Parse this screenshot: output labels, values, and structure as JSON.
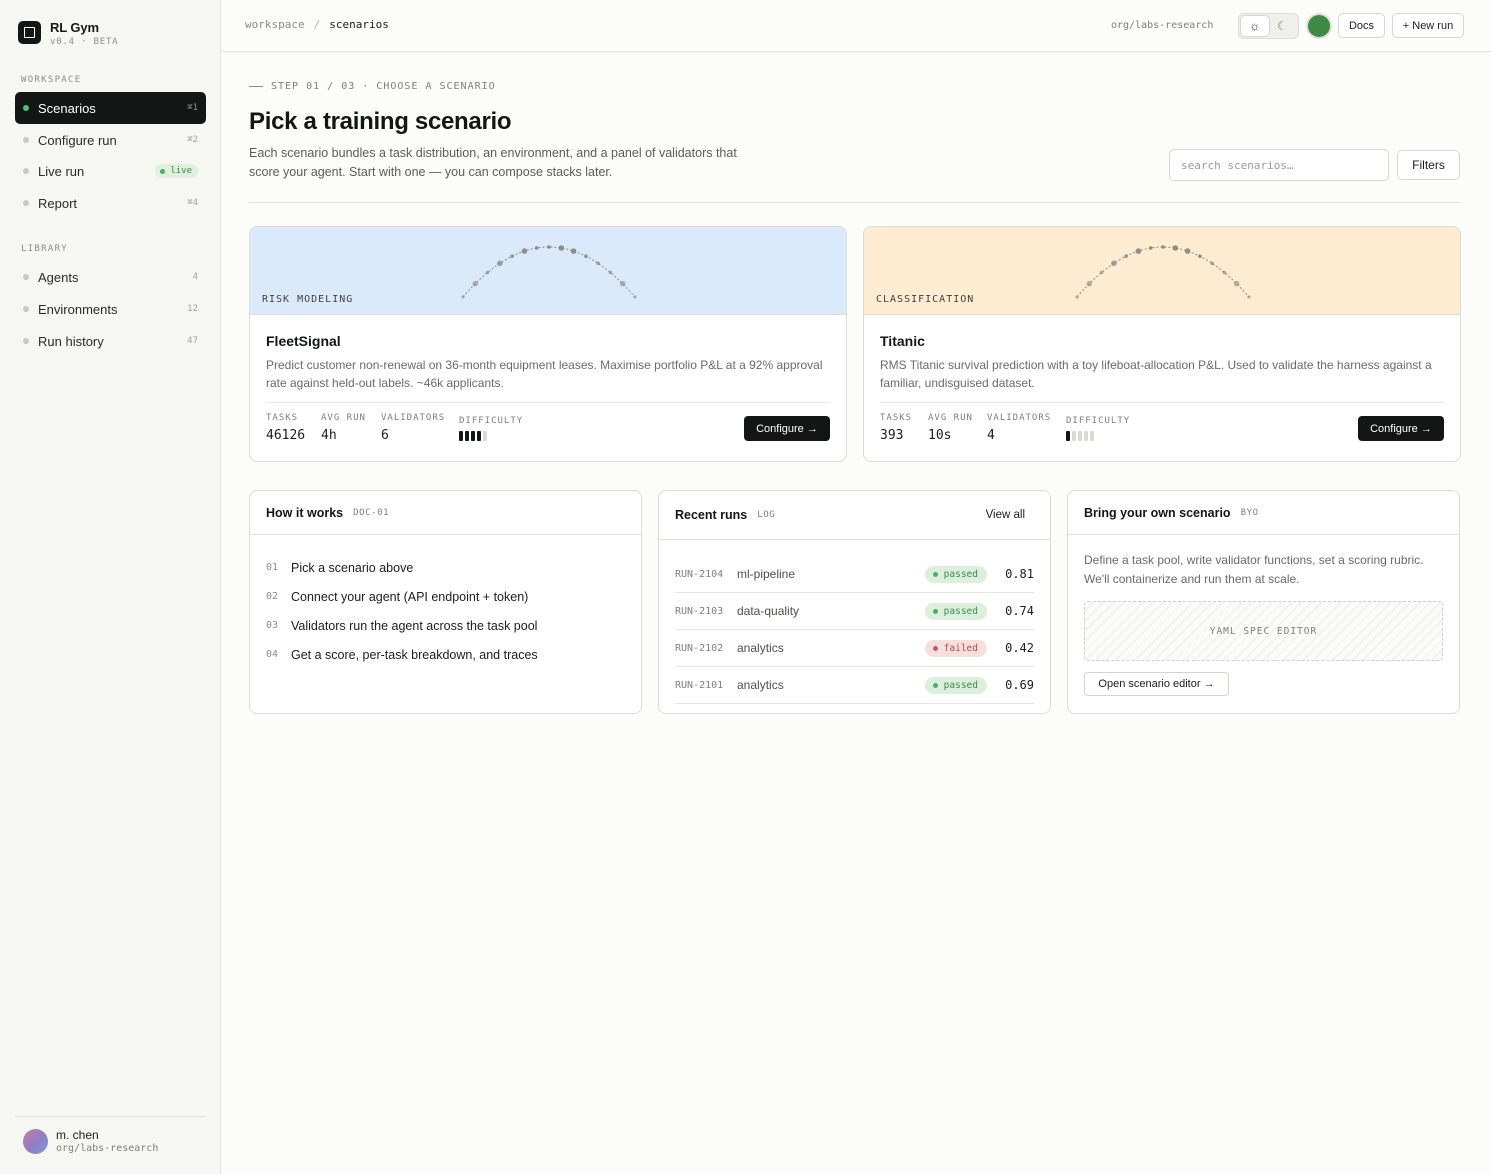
{
  "brand": {
    "name": "RL Gym",
    "version": "v0.4 · BETA"
  },
  "sidebar": {
    "workspace_label": "WORKSPACE",
    "workspace_items": [
      {
        "label": "Scenarios",
        "meta": "⌘1"
      },
      {
        "label": "Configure run",
        "meta": "⌘2"
      },
      {
        "label": "Live run",
        "meta": "live"
      },
      {
        "label": "Report",
        "meta": "⌘4"
      }
    ],
    "library_label": "LIBRARY",
    "library_items": [
      {
        "label": "Agents",
        "meta": "4"
      },
      {
        "label": "Environments",
        "meta": "12"
      },
      {
        "label": "Run history",
        "meta": "47"
      }
    ],
    "user": {
      "name": "m. chen",
      "org": "org/labs-research"
    }
  },
  "topbar": {
    "breadcrumb": [
      "workspace",
      "scenarios"
    ],
    "org": "org/labs-research",
    "theme": "light",
    "docs_label": "Docs",
    "new_run_label": "+ New run",
    "status_color": "#3d8a45"
  },
  "header": {
    "step": "STEP 01 / 03 · CHOOSE A SCENARIO",
    "title": "Pick a training scenario",
    "description": "Each scenario bundles a task distribution, an environment, and a panel of validators that score your agent. Start with one — you can compose stacks later.",
    "search_placeholder": "search scenarios…",
    "filters_label": "Filters"
  },
  "scenarios": [
    {
      "tag": "RISK MODELING",
      "name": "FleetSignal",
      "description": "Predict customer non-renewal on 36-month equipment leases. Maximise portfolio P&L at a 92% approval rate against held-out labels. ~46k applicants.",
      "hero_color": "#dbeafb",
      "stats": {
        "tasks_label": "TASKS",
        "tasks": "46126",
        "avg_run_label": "AVG RUN",
        "avg_run": "4h",
        "validators_label": "VALIDATORS",
        "validators": "6",
        "difficulty_label": "DIFFICULTY",
        "difficulty": 4,
        "difficulty_max": 5
      },
      "configure_label": "Configure →"
    },
    {
      "tag": "CLASSIFICATION",
      "name": "Titanic",
      "description": "RMS Titanic survival prediction with a toy lifeboat-allocation P&L. Used to validate the harness against a familiar, undisguised dataset.",
      "hero_color": "#fdebd2",
      "stats": {
        "tasks_label": "TASKS",
        "tasks": "393",
        "avg_run_label": "AVG RUN",
        "avg_run": "10s",
        "validators_label": "VALIDATORS",
        "validators": "4",
        "difficulty_label": "DIFFICULTY",
        "difficulty": 1,
        "difficulty_max": 5
      },
      "configure_label": "Configure →"
    }
  ],
  "how_it_works": {
    "title": "How it works",
    "tag": "DOC-01",
    "steps": [
      {
        "n": "01",
        "text": "Pick a scenario above"
      },
      {
        "n": "02",
        "text": "Connect your agent (API endpoint + token)"
      },
      {
        "n": "03",
        "text": "Validators run the agent across the task pool"
      },
      {
        "n": "04",
        "text": "Get a score, per-task breakdown, and traces"
      }
    ]
  },
  "recent_runs": {
    "title": "Recent runs",
    "tag": "LOG",
    "view_all_label": "View all",
    "runs": [
      {
        "id": "RUN-2104",
        "name": "ml-pipeline",
        "status": "passed",
        "score": "0.81"
      },
      {
        "id": "RUN-2103",
        "name": "data-quality",
        "status": "passed",
        "score": "0.74"
      },
      {
        "id": "RUN-2102",
        "name": "analytics",
        "status": "failed",
        "score": "0.42"
      },
      {
        "id": "RUN-2101",
        "name": "analytics",
        "status": "passed",
        "score": "0.69"
      }
    ]
  },
  "byo": {
    "title": "Bring your own scenario",
    "tag": "BYO",
    "description": "Define a task pool, write validator functions, set a scoring rubric. We'll containerize and run them at scale.",
    "editor_label": "YAML SPEC EDITOR",
    "open_label": "Open scenario editor →"
  }
}
